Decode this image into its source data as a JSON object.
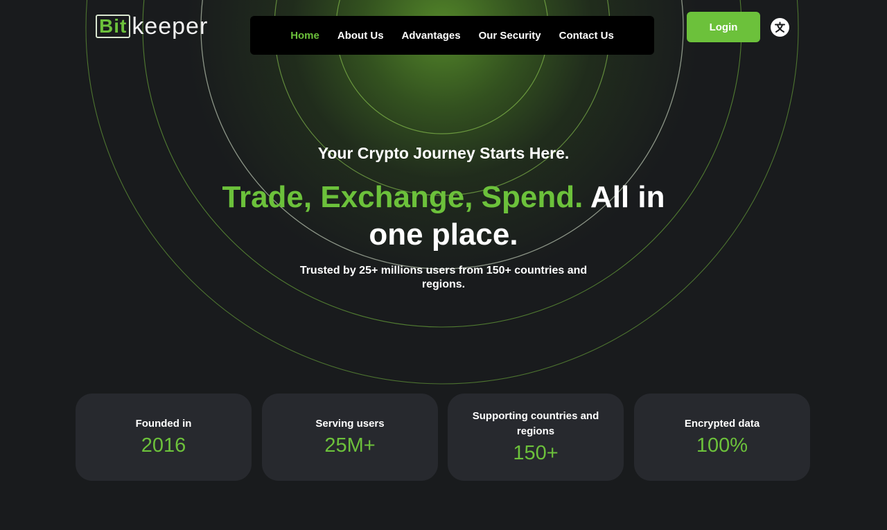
{
  "brand": {
    "logo_boxed": "Bit",
    "logo_rest": "keeper",
    "accent_color": "#6cc13b"
  },
  "nav": {
    "items": [
      {
        "label": "Home",
        "active": true
      },
      {
        "label": "About Us",
        "active": false
      },
      {
        "label": "Advantages",
        "active": false
      },
      {
        "label": "Our Security",
        "active": false
      },
      {
        "label": "Contact Us",
        "active": false
      }
    ]
  },
  "header": {
    "login_label": "Login",
    "language_icon": "translate-icon",
    "language_glyph": "文"
  },
  "hero": {
    "tagline": "Your Crypto Journey Starts Here.",
    "headline_green": "Trade, Exchange, Spend.",
    "headline_white": " All in one place.",
    "subtext": "Trusted by 25+ millions users from 150+ countries and regions."
  },
  "stats": [
    {
      "label": "Founded in",
      "value": "2016"
    },
    {
      "label": "Serving users",
      "value": "25M+"
    },
    {
      "label": "Supporting countries and regions",
      "value": "150+"
    },
    {
      "label": "Encrypted data",
      "value": "100%"
    }
  ]
}
